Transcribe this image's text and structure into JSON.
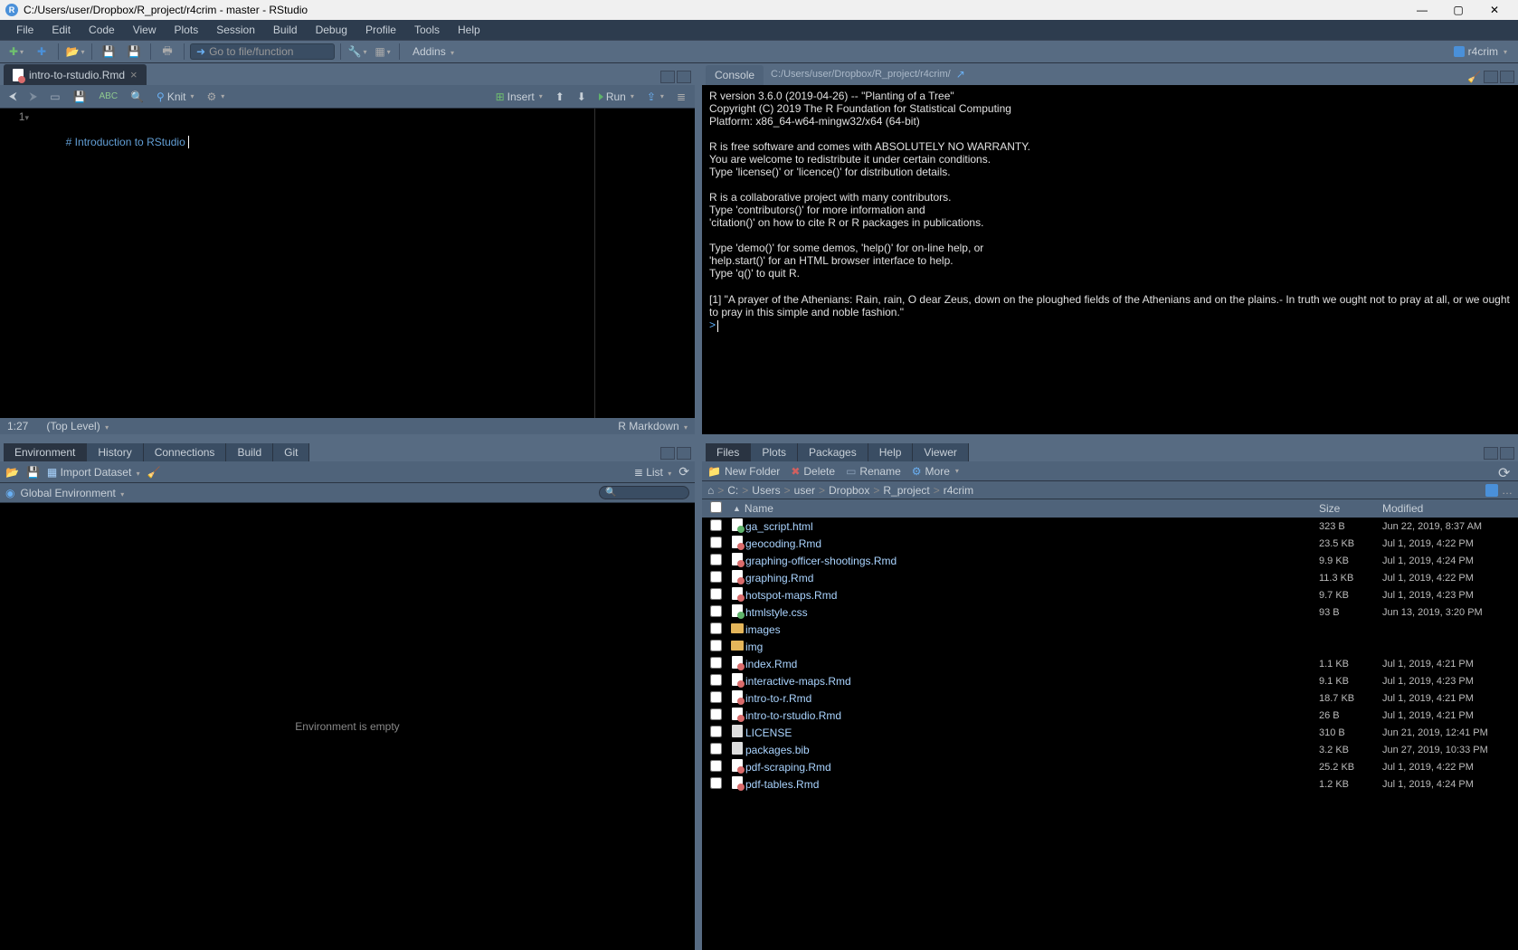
{
  "title": "C:/Users/user/Dropbox/R_project/r4crim - master - RStudio",
  "menu": [
    "File",
    "Edit",
    "Code",
    "View",
    "Plots",
    "Session",
    "Build",
    "Debug",
    "Profile",
    "Tools",
    "Help"
  ],
  "toolbar": {
    "goto_placeholder": "Go to file/function",
    "addins": "Addins",
    "project": "r4crim"
  },
  "source": {
    "tab_name": "intro-to-rstudio.Rmd",
    "line": "1",
    "code": "# Introduction to RStudio ",
    "knit_label": "Knit",
    "insert_label": "Insert",
    "run_label": "Run",
    "status_pos": "1:27",
    "status_scope": "(Top Level)",
    "status_lang": "R Markdown"
  },
  "console": {
    "tab": "Console",
    "path": "C:/Users/user/Dropbox/R_project/r4crim/",
    "body": "R version 3.6.0 (2019-04-26) -- \"Planting of a Tree\"\nCopyright (C) 2019 The R Foundation for Statistical Computing\nPlatform: x86_64-w64-mingw32/x64 (64-bit)\n\nR is free software and comes with ABSOLUTELY NO WARRANTY.\nYou are welcome to redistribute it under certain conditions.\nType 'license()' or 'licence()' for distribution details.\n\nR is a collaborative project with many contributors.\nType 'contributors()' for more information and\n'citation()' on how to cite R or R packages in publications.\n\nType 'demo()' for some demos, 'help()' for on-line help, or\n'help.start()' for an HTML browser interface to help.\nType 'q()' to quit R.\n\n[1] \"A prayer of the Athenians: Rain, rain, O dear Zeus, down on the ploughed fields of the Athenians and on the plains.- In truth we ought not to pray at all, or we ought to pray in this simple and noble fashion.\""
  },
  "env": {
    "tabs": [
      "Environment",
      "History",
      "Connections",
      "Build",
      "Git"
    ],
    "import_label": "Import Dataset",
    "list_label": "List",
    "scope": "Global Environment",
    "empty": "Environment is empty"
  },
  "files": {
    "tabs": [
      "Files",
      "Plots",
      "Packages",
      "Help",
      "Viewer"
    ],
    "newfolder": "New Folder",
    "delete": "Delete",
    "rename": "Rename",
    "more": "More",
    "crumbs": [
      "C:",
      "Users",
      "user",
      "Dropbox",
      "R_project",
      "r4crim"
    ],
    "cols": {
      "name": "Name",
      "size": "Size",
      "mod": "Modified"
    },
    "rows": [
      {
        "icon": "html",
        "name": "ga_script.html",
        "size": "323 B",
        "mod": "Jun 22, 2019, 8:37 AM"
      },
      {
        "icon": "rmd",
        "name": "geocoding.Rmd",
        "size": "23.5 KB",
        "mod": "Jul 1, 2019, 4:22 PM"
      },
      {
        "icon": "rmd",
        "name": "graphing-officer-shootings.Rmd",
        "size": "9.9 KB",
        "mod": "Jul 1, 2019, 4:24 PM"
      },
      {
        "icon": "rmd",
        "name": "graphing.Rmd",
        "size": "11.3 KB",
        "mod": "Jul 1, 2019, 4:22 PM"
      },
      {
        "icon": "rmd",
        "name": "hotspot-maps.Rmd",
        "size": "9.7 KB",
        "mod": "Jul 1, 2019, 4:23 PM"
      },
      {
        "icon": "css",
        "name": "htmlstyle.css",
        "size": "93 B",
        "mod": "Jun 13, 2019, 3:20 PM"
      },
      {
        "icon": "folder",
        "name": "images",
        "size": "",
        "mod": ""
      },
      {
        "icon": "folder",
        "name": "img",
        "size": "",
        "mod": ""
      },
      {
        "icon": "rmd",
        "name": "index.Rmd",
        "size": "1.1 KB",
        "mod": "Jul 1, 2019, 4:21 PM"
      },
      {
        "icon": "rmd",
        "name": "interactive-maps.Rmd",
        "size": "9.1 KB",
        "mod": "Jul 1, 2019, 4:23 PM"
      },
      {
        "icon": "rmd",
        "name": "intro-to-r.Rmd",
        "size": "18.7 KB",
        "mod": "Jul 1, 2019, 4:21 PM"
      },
      {
        "icon": "rmd",
        "name": "intro-to-rstudio.Rmd",
        "size": "26 B",
        "mod": "Jul 1, 2019, 4:21 PM"
      },
      {
        "icon": "file",
        "name": "LICENSE",
        "size": "310 B",
        "mod": "Jun 21, 2019, 12:41 PM"
      },
      {
        "icon": "file",
        "name": "packages.bib",
        "size": "3.2 KB",
        "mod": "Jun 27, 2019, 10:33 PM"
      },
      {
        "icon": "rmd",
        "name": "pdf-scraping.Rmd",
        "size": "25.2 KB",
        "mod": "Jul 1, 2019, 4:22 PM"
      },
      {
        "icon": "rmd",
        "name": "pdf-tables.Rmd",
        "size": "1.2 KB",
        "mod": "Jul 1, 2019, 4:24 PM"
      }
    ]
  }
}
